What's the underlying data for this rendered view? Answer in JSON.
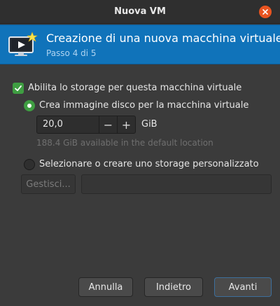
{
  "window": {
    "title": "Nuova VM"
  },
  "header": {
    "title": "Creazione di una nuova macchina virtuale",
    "step": "Passo 4 di 5"
  },
  "storage": {
    "enable_label": "Abilita lo storage per questa macchina virtuale",
    "enable_checked": true,
    "create_disk_label": "Crea immagine disco per la macchina virtuale",
    "create_disk_selected": true,
    "disk_size_value": "20,0",
    "disk_size_unit": "GiB",
    "available_text": "188.4 GiB available in the default location",
    "custom_label": "Selezionare o creare uno storage personalizzato",
    "custom_selected": false,
    "manage_label": "Gestisci...",
    "custom_path_value": ""
  },
  "buttons": {
    "cancel": "Annulla",
    "back": "Indietro",
    "forward": "Avanti"
  },
  "icons": {
    "close": "close-icon",
    "vm": "vm-monitor-icon",
    "minus": "−",
    "plus": "+"
  },
  "colors": {
    "accent_banner": "#1073ba",
    "check_green": "#3f9e42",
    "close_orange": "#e95420"
  }
}
